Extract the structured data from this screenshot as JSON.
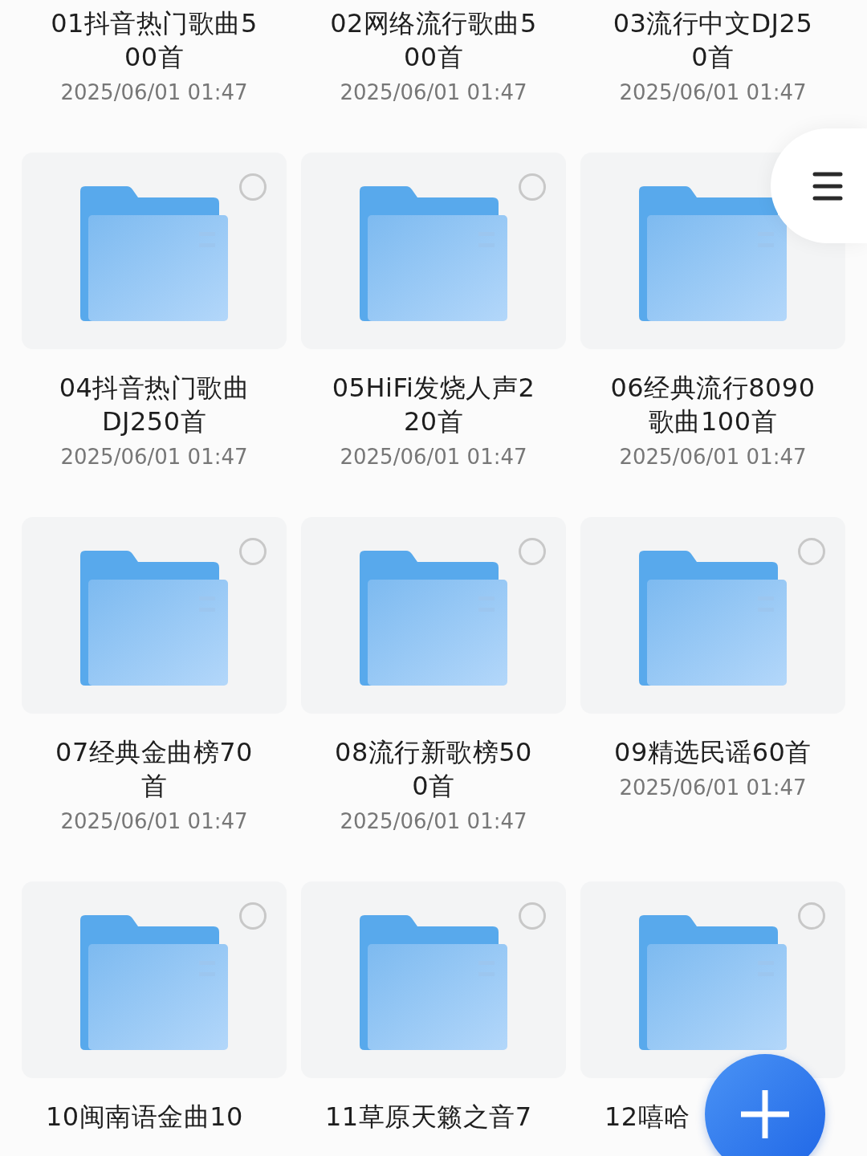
{
  "folders": [
    {
      "kind": "name-only",
      "title": "01抖音热门歌曲5\n00首",
      "date": "2025/06/01 01:47"
    },
    {
      "kind": "name-only",
      "title": "02网络流行歌曲5\n00首",
      "date": "2025/06/01 01:47"
    },
    {
      "kind": "name-only",
      "title": "03流行中文DJ25\n0首",
      "date": "2025/06/01 01:47"
    },
    {
      "kind": "folder",
      "selected": false,
      "title": "04抖音热门歌曲\nDJ250首",
      "date": "2025/06/01 01:47"
    },
    {
      "kind": "folder",
      "selected": false,
      "title": "05HiFi发烧人声2\n20首",
      "date": "2025/06/01 01:47"
    },
    {
      "kind": "folder",
      "title": "06经典流行8090\n歌曲100首",
      "date": "2025/06/01 01:47"
    },
    {
      "kind": "folder",
      "selected": false,
      "title": "07经典金曲榜70\n首",
      "date": "2025/06/01 01:47"
    },
    {
      "kind": "folder",
      "selected": false,
      "title": "08流行新歌榜50\n0首",
      "date": "2025/06/01 01:47"
    },
    {
      "kind": "folder",
      "selected": false,
      "title": "09精选民谣60首",
      "date": "2025/06/01 01:47"
    },
    {
      "kind": "folder",
      "selected": false,
      "title": "10闽南语金曲10"
    },
    {
      "kind": "folder",
      "selected": false,
      "title": "11草原天籁之音7"
    },
    {
      "kind": "folder",
      "selected": false,
      "title": "12嘻哈"
    }
  ]
}
